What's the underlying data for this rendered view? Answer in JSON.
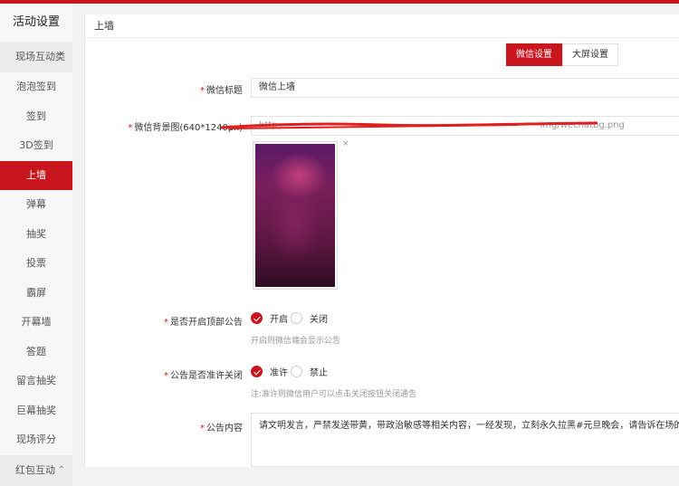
{
  "sidebar": {
    "title": "活动设置",
    "group_main": {
      "label": "现场互动类",
      "icon": "chevron-up-icon"
    },
    "items": [
      {
        "label": "泡泡签到"
      },
      {
        "label": "签到"
      },
      {
        "label": "3D签到"
      },
      {
        "label": "上墙",
        "active": true
      },
      {
        "label": "弹幕"
      },
      {
        "label": "抽奖"
      },
      {
        "label": "投票"
      },
      {
        "label": "霸屏"
      },
      {
        "label": "开幕墙"
      },
      {
        "label": "答题"
      },
      {
        "label": "留言抽奖"
      },
      {
        "label": "巨幕抽奖"
      },
      {
        "label": "现场评分"
      }
    ],
    "group_redpacket": {
      "label": "红包互动",
      "icon": "chevron-up-icon"
    }
  },
  "panel": {
    "title": "上墙",
    "tabs": [
      {
        "label": "微信设置",
        "active": true
      },
      {
        "label": "大屏设置",
        "active": false
      }
    ]
  },
  "form": {
    "title_label": "微信标题",
    "title_value": "微信上墙",
    "bg_label": "微信背景图(640*1240px)",
    "bg_value_prefix": "http",
    "bg_value_suffix": "img/wechatbg.png",
    "bg_remove": "×",
    "top_notice_label": "是否开启顶部公告",
    "top_notice_on": "开启",
    "top_notice_off": "关闭",
    "top_notice_hint": "开启则微信端会显示公告",
    "close_notice_label": "公告是否准许关闭",
    "close_notice_allow": "准许",
    "close_notice_deny": "禁止",
    "close_notice_hint": "注:准许则微信用户可以点击关闭按钮关闭通告",
    "content_label": "公告内容",
    "content_value": "请文明发言，严禁发送带黄，带政治敏感等相关内容，一经发现，立刻永久拉黑#元旦晚会，请告诉在场的所有人你的心声"
  },
  "colors": {
    "accent": "#c9151e"
  }
}
